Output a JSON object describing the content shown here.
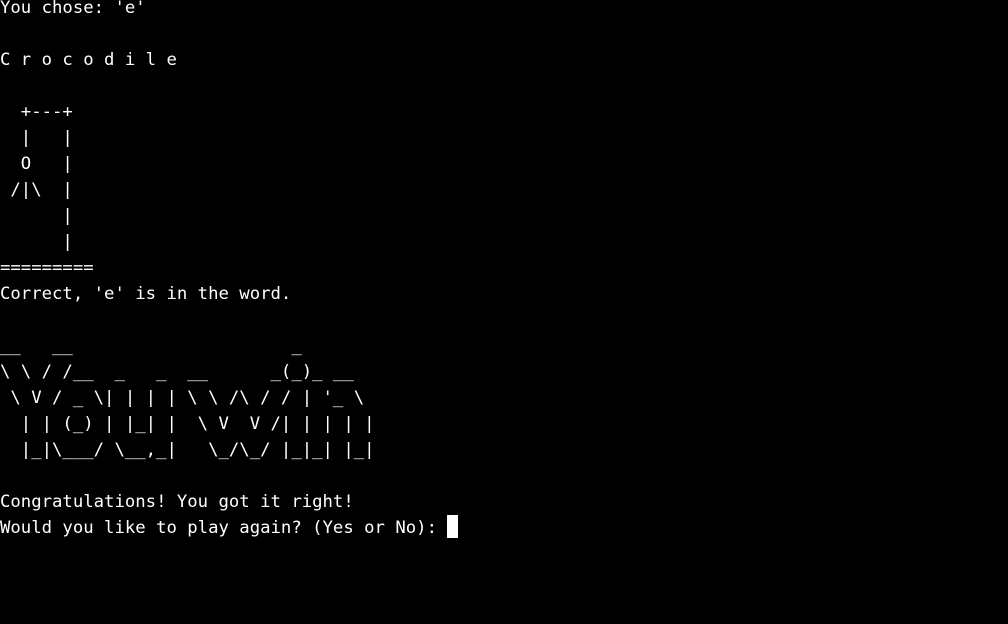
{
  "terminal": {
    "chose_line": "You chose: 'e'",
    "word_display": "C r o c o d i l e",
    "hangman_art": [
      "  +---+",
      "  |   |",
      "  O   |",
      " /|\\  |",
      "      |",
      "      |",
      "========="
    ],
    "result_line": "Correct, 'e' is in the word.",
    "win_banner": [
      "__   __                     _",
      "\\ \\ / /__  _   _  __      _(_)_ __",
      " \\ V / _ \\| | | | \\ \\ /\\ / / | '_ \\",
      "  | | (_) | |_| |  \\ V  V /| | | | |",
      "  |_|\\___/ \\__,_|   \\_/\\_/ |_|_| |_|"
    ],
    "congrats_line": "Congratulations! You got it right!",
    "prompt_line": "Would you like to play again? (Yes or No): ",
    "input_value": ""
  },
  "colors": {
    "background": "#000000",
    "foreground": "#ffffff",
    "cursor": "#ffffff"
  }
}
